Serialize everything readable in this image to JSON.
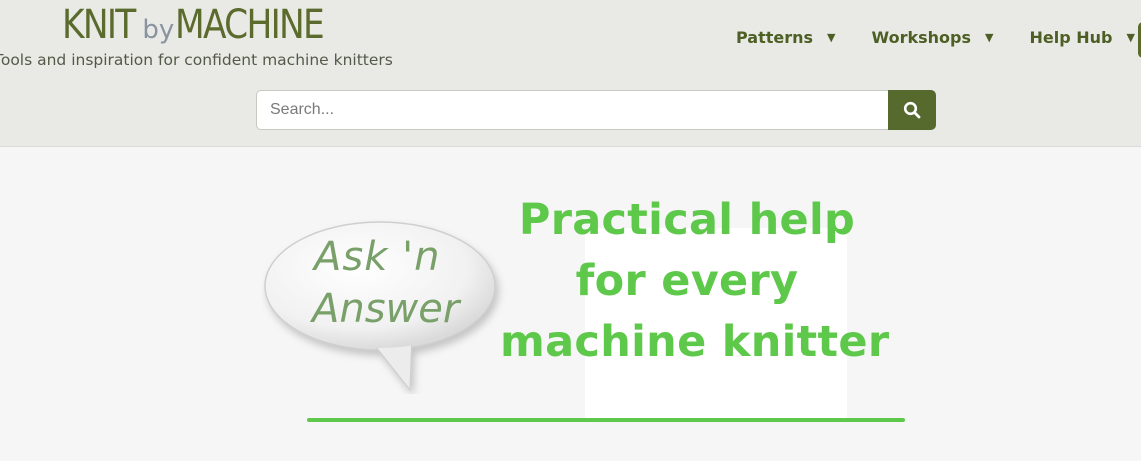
{
  "header": {
    "logo": {
      "knit": "KNIT",
      "by": "by",
      "machine": "MACHINE"
    },
    "tagline": "Tools and inspiration for confident machine knitters",
    "nav": [
      {
        "label": "Patterns"
      },
      {
        "label": "Workshops"
      },
      {
        "label": "Help Hub"
      }
    ],
    "search": {
      "placeholder": "Search...",
      "button_icon": "search-icon"
    }
  },
  "hero": {
    "bubble_text_line1": "Ask 'n",
    "bubble_text_line2": "Answer",
    "title_lines": [
      "Practical help",
      "for every",
      "machine knitter"
    ]
  },
  "colors": {
    "brand_olive": "#5b6b2d",
    "accent_green": "#5ec84a",
    "header_bg": "#e9eae5"
  }
}
